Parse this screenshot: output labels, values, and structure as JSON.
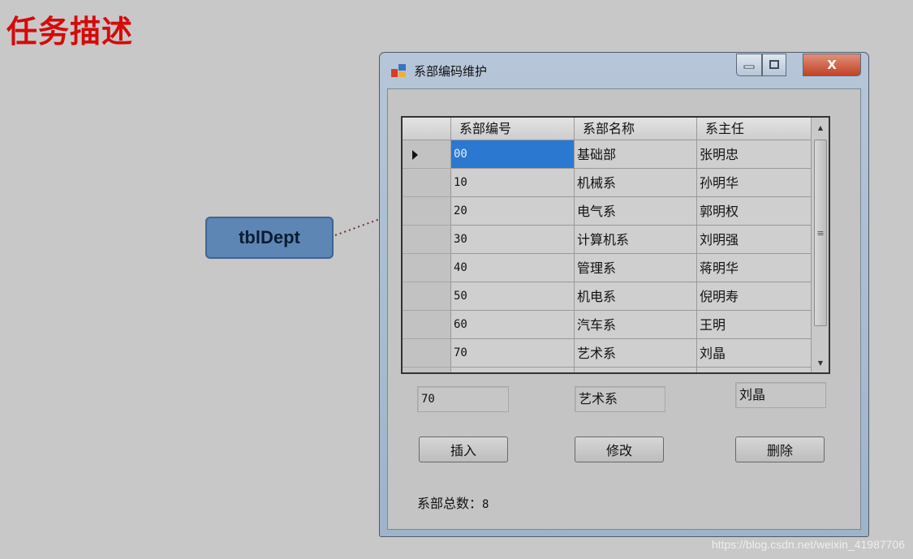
{
  "slide": {
    "title": "任务描述"
  },
  "callout": {
    "label": "tblDept"
  },
  "window": {
    "title": "系部编码维护",
    "close_label": "X",
    "minimize_icon": "minimize-icon",
    "maximize_icon": "maximize-icon"
  },
  "grid": {
    "columns": [
      "系部编号",
      "系部名称",
      "系主任"
    ],
    "rows": [
      [
        "00",
        "基础部",
        "张明忠"
      ],
      [
        "10",
        "机械系",
        "孙明华"
      ],
      [
        "20",
        "电气系",
        "郭明权"
      ],
      [
        "30",
        "计算机系",
        "刘明强"
      ],
      [
        "40",
        "管理系",
        "蒋明华"
      ],
      [
        "50",
        "机电系",
        "倪明寿"
      ],
      [
        "60",
        "汽车系",
        "王明"
      ],
      [
        "70",
        "艺术系",
        "刘晶"
      ]
    ],
    "selected_row": 0,
    "scroll": {
      "up_icon": "▲",
      "down_icon": "▼",
      "grip_icon": "≡"
    }
  },
  "form": {
    "dept_code_value": "70",
    "dept_name_value": "艺术系",
    "dept_head_value": "刘晶",
    "insert_label": "插入",
    "modify_label": "修改",
    "delete_label": "删除",
    "count_label": "系部总数：",
    "count_value": "8"
  },
  "watermark": "https://blog.csdn.net/weixin_41987706",
  "colors": {
    "title_red": "#d60a0a",
    "selection_blue": "#2b78d0",
    "callout_fill": "#5e86b4"
  }
}
